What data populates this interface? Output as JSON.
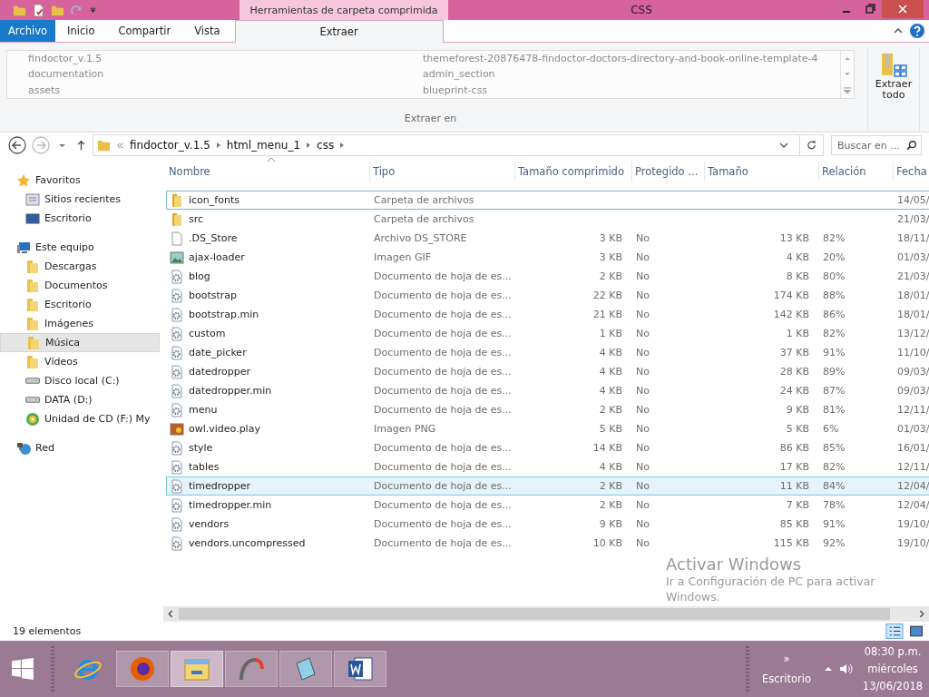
{
  "window": {
    "title": "CSS",
    "context_group": "Herramientas de carpeta comprimida"
  },
  "ribbon_tabs": [
    {
      "label": "Archivo",
      "kind": "file",
      "selected": false
    },
    {
      "label": "Inicio",
      "kind": "tab",
      "selected": false
    },
    {
      "label": "Compartir",
      "kind": "tab",
      "selected": false
    },
    {
      "label": "Vista",
      "kind": "tab",
      "selected": false
    },
    {
      "label": "Extraer",
      "kind": "context",
      "selected": true
    }
  ],
  "extract": {
    "destinations": [
      "findoctor_v.1.5",
      "documentation",
      "assets",
      "themeforest-20876478-findoctor-doctors-directory-and-book-online-template-4",
      "admin_section",
      "blueprint-css"
    ],
    "group_label": "Extraer en",
    "extract_all": "Extraer todo"
  },
  "address_bar": {
    "path": [
      "findoctor_v.1.5",
      "html_menu_1",
      "css"
    ]
  },
  "search": {
    "placeholder": "Buscar en ..."
  },
  "sidebar": [
    {
      "label": "Favoritos",
      "kind": "star",
      "selected": false,
      "children": [
        {
          "label": "Sitios recientes",
          "kind": "recent",
          "selected": false
        },
        {
          "label": "Escritorio",
          "kind": "desktop",
          "selected": false
        }
      ]
    },
    {
      "label": "Este equipo",
      "kind": "computer",
      "selected": false,
      "children": [
        {
          "label": "Descargas",
          "kind": "folder",
          "selected": false
        },
        {
          "label": "Documentos",
          "kind": "folder",
          "selected": false
        },
        {
          "label": "Escritorio",
          "kind": "folder",
          "selected": false
        },
        {
          "label": "Imágenes",
          "kind": "folder",
          "selected": false
        },
        {
          "label": "Música",
          "kind": "folder",
          "selected": true
        },
        {
          "label": "Vídeos",
          "kind": "folder",
          "selected": false
        },
        {
          "label": "Disco local (C:)",
          "kind": "drive",
          "selected": false
        },
        {
          "label": "DATA (D:)",
          "kind": "drive",
          "selected": false
        },
        {
          "label": "Unidad de CD (F:) My",
          "kind": "cd",
          "selected": false
        }
      ]
    },
    {
      "label": "Red",
      "kind": "network",
      "selected": false
    }
  ],
  "table": {
    "columns": [
      {
        "label": "Nombre",
        "sorted": true
      },
      {
        "label": "Tipo",
        "sorted": false
      },
      {
        "label": "Tamaño comprimido",
        "sorted": false
      },
      {
        "label": "Protegido ...",
        "sorted": false
      },
      {
        "label": "Tamaño",
        "sorted": false
      },
      {
        "label": "Relación",
        "sorted": false
      },
      {
        "label": "Fecha",
        "sorted": false
      }
    ],
    "rows": [
      {
        "kind": "folder",
        "name": "icon_fonts",
        "type": "Carpeta de archivos",
        "packed": "",
        "protected": "",
        "size": "",
        "ratio": "",
        "date": "14/05/",
        "selected": false,
        "focused": true
      },
      {
        "kind": "folder",
        "name": "src",
        "type": "Carpeta de archivos",
        "packed": "",
        "protected": "",
        "size": "",
        "ratio": "",
        "date": "21/03/",
        "selected": false,
        "focused": false
      },
      {
        "kind": "blank",
        "name": ".DS_Store",
        "type": "Archivo DS_STORE",
        "packed": "3 KB",
        "protected": "No",
        "size": "13 KB",
        "ratio": "82%",
        "date": "18/11/",
        "selected": false,
        "focused": false
      },
      {
        "kind": "image",
        "name": "ajax-loader",
        "type": "Imagen GIF",
        "packed": "3 KB",
        "protected": "No",
        "size": "4 KB",
        "ratio": "20%",
        "date": "01/03/",
        "selected": false,
        "focused": false
      },
      {
        "kind": "css",
        "name": "blog",
        "type": "Documento de hoja de es...",
        "packed": "2 KB",
        "protected": "No",
        "size": "8 KB",
        "ratio": "80%",
        "date": "21/03/",
        "selected": false,
        "focused": false
      },
      {
        "kind": "css",
        "name": "bootstrap",
        "type": "Documento de hoja de es...",
        "packed": "22 KB",
        "protected": "No",
        "size": "174 KB",
        "ratio": "88%",
        "date": "18/01/",
        "selected": false,
        "focused": false
      },
      {
        "kind": "css",
        "name": "bootstrap.min",
        "type": "Documento de hoja de es...",
        "packed": "21 KB",
        "protected": "No",
        "size": "142 KB",
        "ratio": "86%",
        "date": "18/01/",
        "selected": false,
        "focused": false
      },
      {
        "kind": "css",
        "name": "custom",
        "type": "Documento de hoja de es...",
        "packed": "1 KB",
        "protected": "No",
        "size": "1 KB",
        "ratio": "82%",
        "date": "13/12/",
        "selected": false,
        "focused": false
      },
      {
        "kind": "css",
        "name": "date_picker",
        "type": "Documento de hoja de es...",
        "packed": "4 KB",
        "protected": "No",
        "size": "37 KB",
        "ratio": "91%",
        "date": "11/10/",
        "selected": false,
        "focused": false
      },
      {
        "kind": "css",
        "name": "datedropper",
        "type": "Documento de hoja de es...",
        "packed": "4 KB",
        "protected": "No",
        "size": "28 KB",
        "ratio": "89%",
        "date": "09/03/",
        "selected": false,
        "focused": false
      },
      {
        "kind": "css",
        "name": "datedropper.min",
        "type": "Documento de hoja de es...",
        "packed": "4 KB",
        "protected": "No",
        "size": "24 KB",
        "ratio": "87%",
        "date": "09/03/",
        "selected": false,
        "focused": false
      },
      {
        "kind": "css",
        "name": "menu",
        "type": "Documento de hoja de es...",
        "packed": "2 KB",
        "protected": "No",
        "size": "9 KB",
        "ratio": "81%",
        "date": "12/11/",
        "selected": false,
        "focused": false
      },
      {
        "kind": "png",
        "name": "owl.video.play",
        "type": "Imagen PNG",
        "packed": "5 KB",
        "protected": "No",
        "size": "5 KB",
        "ratio": "6%",
        "date": "01/03/",
        "selected": false,
        "focused": false
      },
      {
        "kind": "css",
        "name": "style",
        "type": "Documento de hoja de es...",
        "packed": "14 KB",
        "protected": "No",
        "size": "86 KB",
        "ratio": "85%",
        "date": "16/01/",
        "selected": false,
        "focused": false
      },
      {
        "kind": "css",
        "name": "tables",
        "type": "Documento de hoja de es...",
        "packed": "4 KB",
        "protected": "No",
        "size": "17 KB",
        "ratio": "82%",
        "date": "12/11/",
        "selected": false,
        "focused": false
      },
      {
        "kind": "css",
        "name": "timedropper",
        "type": "Documento de hoja de es...",
        "packed": "2 KB",
        "protected": "No",
        "size": "11 KB",
        "ratio": "84%",
        "date": "12/04/",
        "selected": true,
        "focused": false
      },
      {
        "kind": "css",
        "name": "timedropper.min",
        "type": "Documento de hoja de es...",
        "packed": "2 KB",
        "protected": "No",
        "size": "7 KB",
        "ratio": "78%",
        "date": "12/04/",
        "selected": false,
        "focused": false
      },
      {
        "kind": "css",
        "name": "vendors",
        "type": "Documento de hoja de es...",
        "packed": "9 KB",
        "protected": "No",
        "size": "85 KB",
        "ratio": "91%",
        "date": "19/10/",
        "selected": false,
        "focused": false
      },
      {
        "kind": "css",
        "name": "vendors.uncompressed",
        "type": "Documento de hoja de es...",
        "packed": "10 KB",
        "protected": "No",
        "size": "115 KB",
        "ratio": "92%",
        "date": "19/10/",
        "selected": false,
        "focused": false
      }
    ]
  },
  "activation_notice": {
    "title": "Activar Windows",
    "message": "Ir a Configuración de PC para activar Windows."
  },
  "status_bar": {
    "count": "19 elementos",
    "views": [
      {
        "kind": "details",
        "selected": true
      },
      {
        "kind": "tiles",
        "selected": false
      }
    ]
  },
  "taskbar": {
    "apps": [
      {
        "kind": "ie",
        "running": false,
        "active": false
      },
      {
        "kind": "firefox",
        "running": true,
        "active": false
      },
      {
        "kind": "explorer",
        "running": true,
        "active": true
      },
      {
        "kind": "arc",
        "running": true,
        "active": false
      },
      {
        "kind": "notepad",
        "running": true,
        "active": false
      },
      {
        "kind": "word",
        "running": true,
        "active": false
      }
    ],
    "overflow": "»",
    "desktop_label": "Escritorio",
    "time": "08:30 p.m.",
    "day": "miércoles",
    "date": "13/06/2018"
  }
}
